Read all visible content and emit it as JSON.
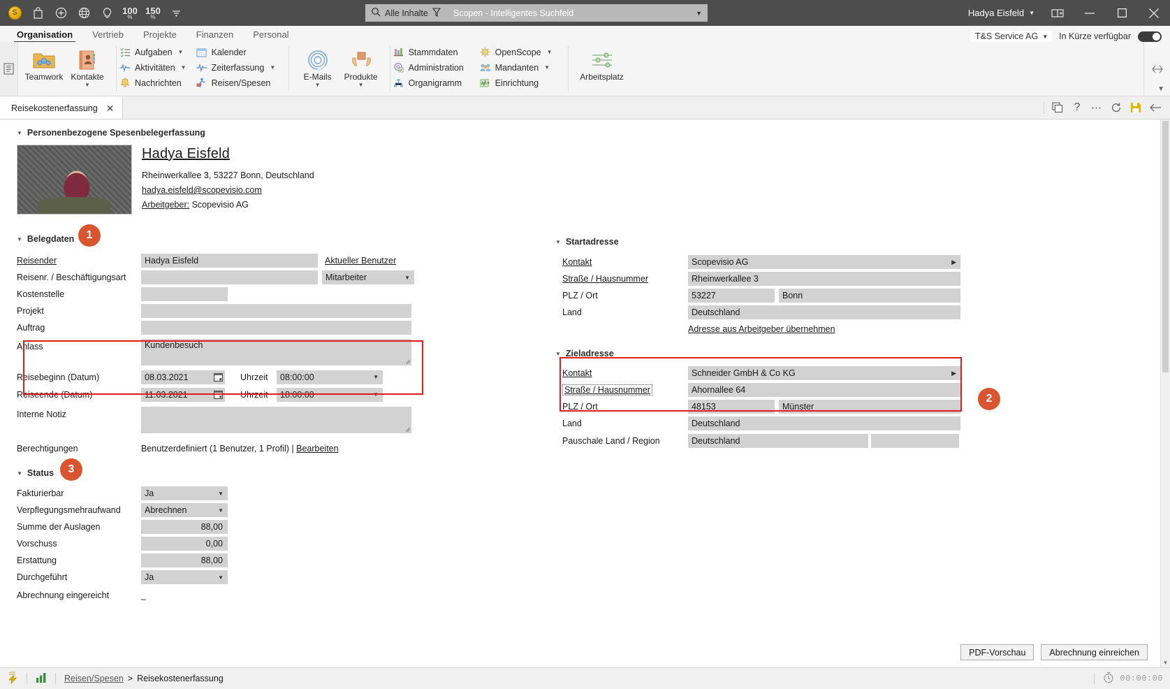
{
  "titlebar": {
    "icons": [
      "coin-icon",
      "bag-icon",
      "plus-circle-icon",
      "globe-icon",
      "lightbulb-icon"
    ],
    "zoom_100": "100",
    "zoom_150": "150",
    "percent_symbol": "%",
    "overflow_icon": "overflow-caret-icon",
    "search_scope": "Alle Inhalte",
    "search_filter_icon": "filter-icon",
    "search_placeholder": "Scopen - Intelligentes Suchfeld",
    "search_value": "Scopen - Intelligentes Suchfeld",
    "user_name": "Hadya Eisfeld",
    "restore_panel_icon": "panel-icon",
    "minimize": "minimize-icon",
    "maximize": "maximize-icon",
    "close": "close-icon"
  },
  "menu": {
    "tabs": [
      {
        "label": "Organisation",
        "active": true
      },
      {
        "label": "Vertrieb",
        "active": false
      },
      {
        "label": "Projekte",
        "active": false
      },
      {
        "label": "Finanzen",
        "active": false
      },
      {
        "label": "Personal",
        "active": false
      }
    ],
    "tenant": "T&S Service AG",
    "toggle_label": "In Kürze verfügbar",
    "toggle_on": true
  },
  "ribbon": {
    "big_buttons": [
      {
        "label": "Teamwork",
        "icon": "teamwork-folder-icon",
        "has_caret": false
      },
      {
        "label": "Kontakte",
        "icon": "contacts-book-icon",
        "has_caret": true
      },
      {
        "label": "E-Mails",
        "icon": "at-sign-icon",
        "has_caret": true
      },
      {
        "label": "Produkte",
        "icon": "product-box-icon",
        "has_caret": true
      },
      {
        "label": "Arbeitsplatz",
        "icon": "sliders-icon",
        "has_caret": false
      }
    ],
    "group1": [
      {
        "label": "Aufgaben",
        "icon": "tasklist-icon",
        "has_caret": true
      },
      {
        "label": "Aktivitäten",
        "icon": "pulse-icon",
        "has_caret": true
      },
      {
        "label": "Nachrichten",
        "icon": "bell-icon",
        "has_caret": false
      }
    ],
    "group2": [
      {
        "label": "Kalender",
        "icon": "calendar-icon",
        "has_caret": false
      },
      {
        "label": "Zeiterfassung",
        "icon": "pulse-icon",
        "has_caret": true
      },
      {
        "label": "Reisen/Spesen",
        "icon": "traveler-icon",
        "has_caret": false
      }
    ],
    "group3": [
      {
        "label": "Stammdaten",
        "icon": "books-icon",
        "has_caret": false
      },
      {
        "label": "Administration",
        "icon": "admin-gear-icon",
        "has_caret": false
      },
      {
        "label": "Organigramm",
        "icon": "orgchart-icon",
        "has_caret": false
      }
    ],
    "group4": [
      {
        "label": "OpenScope",
        "icon": "openscope-icon",
        "has_caret": true
      },
      {
        "label": "Mandanten",
        "icon": "clients-icon",
        "has_caret": true
      },
      {
        "label": "Einrichtung",
        "icon": "setup-chart-icon",
        "has_caret": false
      }
    ],
    "collapse_icon": "chevron-down-icon",
    "rail_icon": "split-view-icon"
  },
  "doctabs": {
    "open_tab": "Reisekostenerfassung",
    "close_icon": "close-icon",
    "actions": [
      "duplicate-icon",
      "help-icon",
      "more-icon",
      "refresh-icon",
      "save-icon",
      "back-arrow-icon"
    ],
    "save_color": "#e2b400"
  },
  "form": {
    "top_section_title": "Personenbezogene Spesenbelegerfassung",
    "person": {
      "name": "Hadya Eisfeld",
      "address": "Rheinwerkallee 3, 53227 Bonn, Deutschland",
      "email": "hadya.eisfeld@scopevisio.com",
      "employer_label": "Arbeitgeber:",
      "employer_value": "Scopevisio AG",
      "photo_alt": "portrait-photo"
    },
    "belegdaten": {
      "title": "Belegdaten",
      "badge": "1",
      "rows": [
        {
          "label": "Reisender",
          "value": "Hadya Eisfeld",
          "link": "Aktueller Benutzer"
        },
        {
          "label": "Reisenr. / Beschäftigungsart",
          "value": "",
          "select": "Mitarbeiter"
        },
        {
          "label": "Kostenstelle",
          "value": ""
        },
        {
          "label": "Projekt",
          "value": ""
        },
        {
          "label": "Auftrag",
          "value": ""
        },
        {
          "label": "Anlass",
          "value": "Kundenbesuch"
        }
      ],
      "reisebeginn_label": "Reisebeginn (Datum)",
      "reisebeginn_date": "08.03.2021",
      "reisebeginn_time_label": "Uhrzeit",
      "reisebeginn_time": "08:00:00",
      "reiseende_label": "Reiseende (Datum)",
      "reiseende_date": "11.03.2021",
      "reiseende_time_label": "Uhrzeit",
      "reiseende_time": "18:00:00",
      "interne_notiz_label": "Interne Notiz",
      "interne_notiz_value": "",
      "berechtigungen_label": "Berechtigungen",
      "berechtigungen_value": "Benutzerdefiniert (1 Benutzer, 1 Profil) |",
      "berechtigungen_link": "Bearbeiten",
      "calendar_icon": "calendar-picker-icon"
    },
    "status": {
      "title": "Status",
      "badge": "3",
      "rows": [
        {
          "label": "Fakturierbar",
          "value": "Ja",
          "type": "select"
        },
        {
          "label": "Verpflegungsmehraufwand",
          "value": "Abrechnen",
          "type": "select"
        },
        {
          "label": "Summe der Auslagen",
          "value": "88,00",
          "type": "number"
        },
        {
          "label": "Vorschuss",
          "value": "0,00",
          "type": "number"
        },
        {
          "label": "Erstattung",
          "value": "88,00",
          "type": "number"
        },
        {
          "label": "Durchgeführt",
          "value": "Ja",
          "type": "select"
        },
        {
          "label": "Abrechnung eingereicht",
          "value": "_",
          "type": "plain"
        }
      ]
    },
    "startadresse": {
      "title": "Startadresse",
      "kontakt_label": "Kontakt",
      "kontakt_value": "Scopevisio AG",
      "strasse_label": "Straße / Hausnummer",
      "strasse_value": "Rheinwerkallee 3",
      "plz_ort_label": "PLZ / Ort",
      "plz_value": "53227",
      "ort_value": "Bonn",
      "land_label": "Land",
      "land_value": "Deutschland",
      "takeover_link": "Adresse aus Arbeitgeber übernehmen"
    },
    "zieladresse": {
      "title": "Zieladresse",
      "badge": "2",
      "kontakt_label": "Kontakt",
      "kontakt_value": "Schneider GmbH & Co KG",
      "strasse_label": "Straße / Hausnummer",
      "strasse_value": "Ahornallee 64",
      "plz_ort_label": "PLZ / Ort",
      "plz_value": "48153",
      "ort_value": "Münster",
      "land_label": "Land",
      "land_value": "Deutschland",
      "pauschale_label": "Pauschale Land / Region",
      "pauschale_value": "Deutschland",
      "pauschale_value2": ""
    },
    "footer": {
      "pdf_button": "PDF-Vorschau",
      "submit_button": "Abrechnung einreichen",
      "expander_icon": "chevron-down-icon"
    }
  },
  "statusbar": {
    "left_icon": "lightning-icon",
    "chart_icon": "bar-chart-icon",
    "breadcrumb_root": "Reisen/Spesen",
    "breadcrumb_sep": ">",
    "breadcrumb_current": "Reisekostenerfassung",
    "timer_icon": "stopwatch-icon",
    "timer_value": "00:00:00"
  },
  "colors": {
    "accent_orange": "#d9552f",
    "highlight_red": "#e21b1b",
    "titlebar": "#4d4d4d",
    "field_gray": "#d2d2d2"
  }
}
